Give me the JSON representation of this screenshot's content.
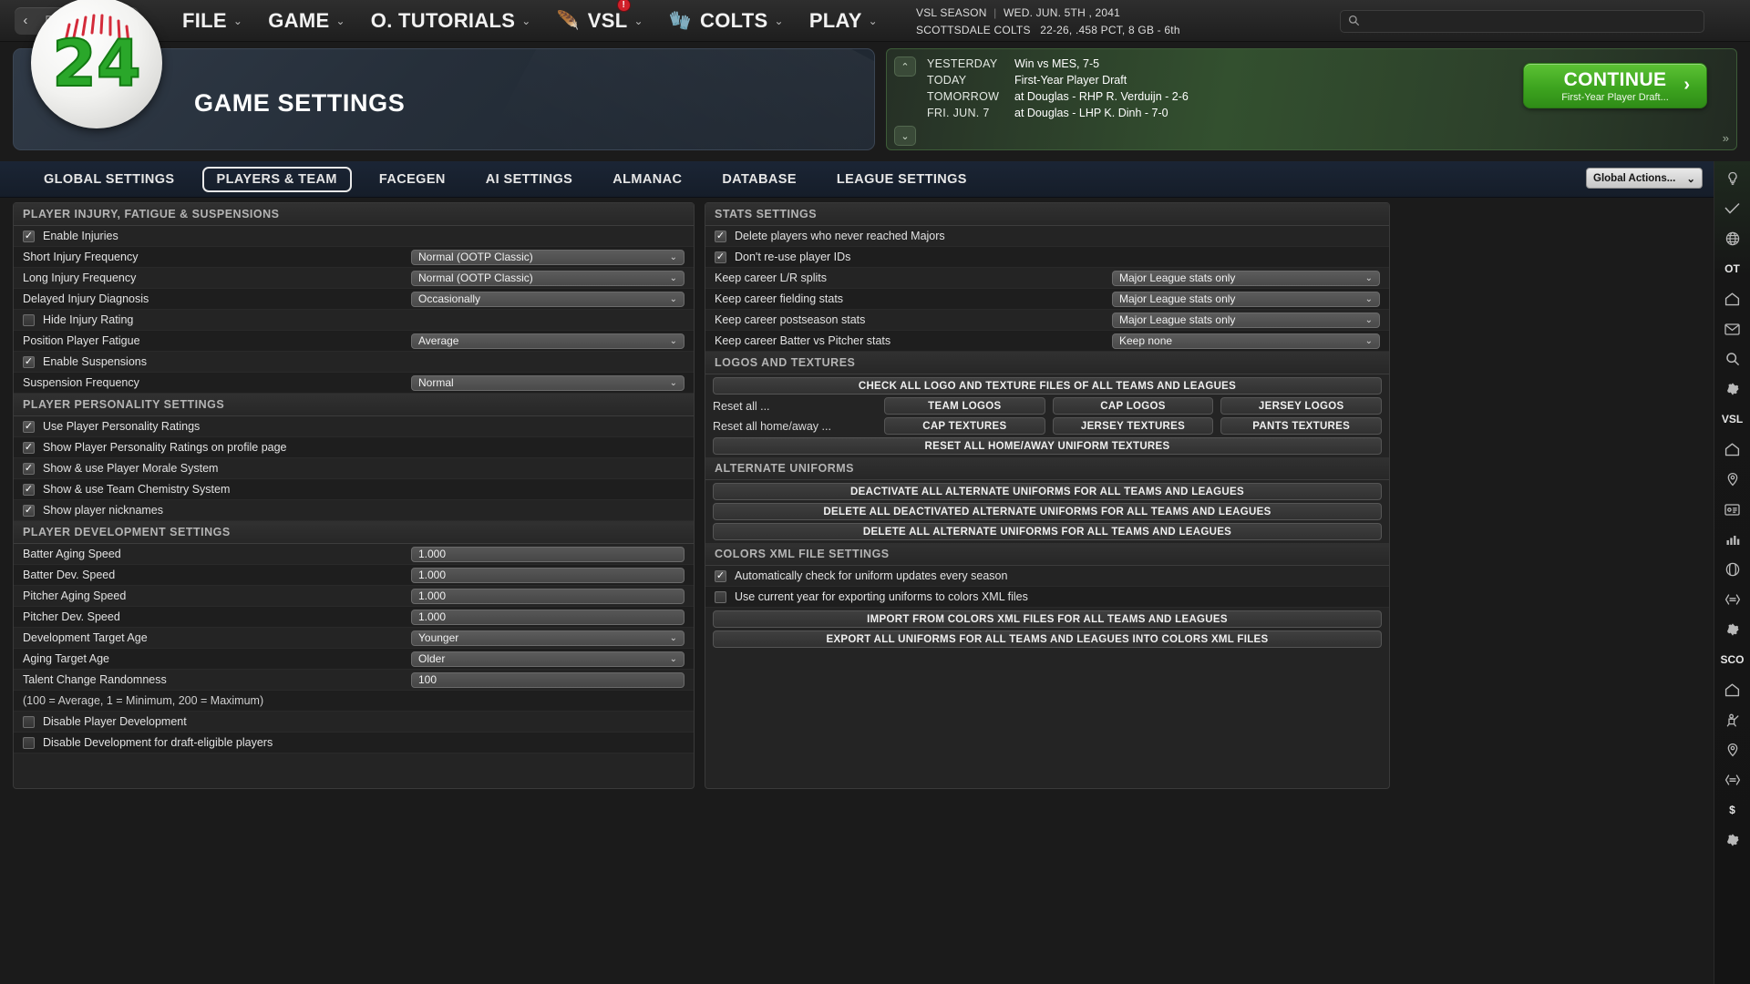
{
  "topbar": {
    "nav": {
      "back": "‹",
      "tab": "▯",
      "forward": "›",
      "favorite": "☆",
      "home": "⌂"
    },
    "menus": [
      {
        "label": "FILE",
        "icon": null,
        "badge": null
      },
      {
        "label": "GAME",
        "icon": null,
        "badge": null
      },
      {
        "label": "O. TUTORIALS",
        "icon": null,
        "badge": null
      },
      {
        "label": "VSL",
        "icon": "🪶",
        "badge": "!"
      },
      {
        "label": "COLTS",
        "icon": "🧤",
        "badge": null
      },
      {
        "label": "PLAY",
        "icon": null,
        "badge": null
      }
    ],
    "chevron": "⌄",
    "season_label": "VSL SEASON",
    "season_date": "WED. JUN. 5TH , 2041",
    "team_name": "SCOTTSDALE COLTS",
    "team_record": "22-26, .458 PCT, 8 GB - 6th",
    "search_placeholder": ""
  },
  "banner": {
    "title": "GAME SETTINGS",
    "logo_number": "24"
  },
  "schedule": {
    "rows": [
      {
        "when": "YESTERDAY",
        "what": "Win vs MES, 7-5"
      },
      {
        "when": "TODAY",
        "what": "First-Year Player Draft"
      },
      {
        "when": "TOMORROW",
        "what": "at Douglas - RHP R. Verduijn - 2-6"
      },
      {
        "when": "FRI. JUN. 7",
        "what": "at Douglas - LHP K. Dinh - 7-0"
      }
    ],
    "continue_label": "CONTINUE",
    "continue_sub": "First-Year Player Draft...",
    "continue_arrow": "›",
    "up_arrow": "⌃",
    "down_arrow": "⌄",
    "expand": "»"
  },
  "tabs": [
    {
      "label": "GLOBAL SETTINGS",
      "active": false
    },
    {
      "label": "PLAYERS & TEAM",
      "active": true
    },
    {
      "label": "FACEGEN",
      "active": false
    },
    {
      "label": "AI SETTINGS",
      "active": false
    },
    {
      "label": "ALMANAC",
      "active": false
    },
    {
      "label": "DATABASE",
      "active": false
    },
    {
      "label": "LEAGUE SETTINGS",
      "active": false
    }
  ],
  "global_actions": {
    "label": "Global Actions...",
    "chevron": "⌄"
  },
  "left_panel": {
    "sections": [
      {
        "title": "PLAYER INJURY, FATIGUE & SUSPENSIONS",
        "rows": [
          {
            "type": "checkbox",
            "label": "Enable Injuries",
            "checked": true
          },
          {
            "type": "select",
            "label": "Short Injury Frequency",
            "value": "Normal (OOTP Classic)"
          },
          {
            "type": "select",
            "label": "Long Injury Frequency",
            "value": "Normal (OOTP Classic)"
          },
          {
            "type": "select",
            "label": "Delayed Injury Diagnosis",
            "value": "Occasionally"
          },
          {
            "type": "checkbox",
            "label": "Hide Injury Rating",
            "checked": false
          },
          {
            "type": "select",
            "label": "Position Player Fatigue",
            "value": "Average"
          },
          {
            "type": "checkbox",
            "label": "Enable Suspensions",
            "checked": true
          },
          {
            "type": "select",
            "label": "Suspension Frequency",
            "value": "Normal"
          }
        ]
      },
      {
        "title": "PLAYER PERSONALITY SETTINGS",
        "rows": [
          {
            "type": "checkbox",
            "label": "Use Player Personality Ratings",
            "checked": true
          },
          {
            "type": "checkbox",
            "label": "Show Player Personality Ratings on profile page",
            "checked": true
          },
          {
            "type": "checkbox",
            "label": "Show & use Player Morale System",
            "checked": true
          },
          {
            "type": "checkbox",
            "label": "Show & use Team Chemistry System",
            "checked": true
          },
          {
            "type": "checkbox",
            "label": "Show player nicknames",
            "checked": true
          }
        ]
      },
      {
        "title": "PLAYER DEVELOPMENT SETTINGS",
        "rows": [
          {
            "type": "text",
            "label": "Batter Aging Speed",
            "value": "1.000"
          },
          {
            "type": "text",
            "label": "Batter Dev. Speed",
            "value": "1.000"
          },
          {
            "type": "text",
            "label": "Pitcher Aging Speed",
            "value": "1.000"
          },
          {
            "type": "text",
            "label": "Pitcher Dev. Speed",
            "value": "1.000"
          },
          {
            "type": "select",
            "label": "Development Target Age",
            "value": "Younger"
          },
          {
            "type": "select",
            "label": "Aging Target Age",
            "value": "Older"
          },
          {
            "type": "text",
            "label": "Talent Change Randomness",
            "value": "100"
          },
          {
            "type": "note",
            "label": "(100 = Average, 1 = Minimum, 200 = Maximum)"
          },
          {
            "type": "checkbox",
            "label": "Disable Player Development",
            "checked": false
          },
          {
            "type": "checkbox",
            "label": "Disable Development for draft-eligible players",
            "checked": false
          }
        ]
      }
    ]
  },
  "right_panel": {
    "sections": [
      {
        "title": "STATS SETTINGS",
        "rows": [
          {
            "type": "checkbox",
            "label": "Delete players who never reached Majors",
            "checked": true
          },
          {
            "type": "checkbox",
            "label": "Don't re-use player IDs",
            "checked": true
          },
          {
            "type": "select",
            "label": "Keep career L/R splits",
            "value": "Major League stats only"
          },
          {
            "type": "select",
            "label": "Keep career fielding stats",
            "value": "Major League stats only"
          },
          {
            "type": "select",
            "label": "Keep career postseason stats",
            "value": "Major League stats only"
          },
          {
            "type": "select",
            "label": "Keep career Batter vs Pitcher stats",
            "value": "Keep none"
          }
        ]
      },
      {
        "title": "LOGOS AND TEXTURES",
        "rows": [
          {
            "type": "button-full",
            "label": "CHECK ALL LOGO AND TEXTURE FILES OF ALL TEAMS AND LEAGUES"
          },
          {
            "type": "button-group",
            "label": "Reset all ...",
            "buttons": [
              "TEAM LOGOS",
              "CAP LOGOS",
              "JERSEY LOGOS"
            ]
          },
          {
            "type": "button-group",
            "label": "Reset all home/away ...",
            "buttons": [
              "CAP TEXTURES",
              "JERSEY TEXTURES",
              "PANTS TEXTURES"
            ]
          },
          {
            "type": "button-full",
            "label": "RESET ALL HOME/AWAY UNIFORM TEXTURES"
          }
        ]
      },
      {
        "title": "ALTERNATE UNIFORMS",
        "rows": [
          {
            "type": "button-full",
            "label": "DEACTIVATE ALL ALTERNATE UNIFORMS FOR ALL TEAMS AND LEAGUES"
          },
          {
            "type": "button-full",
            "label": "DELETE ALL DEACTIVATED ALTERNATE UNIFORMS FOR ALL TEAMS AND LEAGUES"
          },
          {
            "type": "button-full",
            "label": "DELETE ALL ALTERNATE UNIFORMS FOR ALL TEAMS AND LEAGUES"
          }
        ]
      },
      {
        "title": "COLORS XML FILE SETTINGS",
        "rows": [
          {
            "type": "checkbox",
            "label": "Automatically check for uniform updates every season",
            "checked": true
          },
          {
            "type": "checkbox",
            "label": "Use current year for exporting uniforms to colors XML files",
            "checked": false
          },
          {
            "type": "button-full",
            "label": "IMPORT FROM COLORS XML FILES FOR ALL TEAMS AND LEAGUES"
          },
          {
            "type": "button-full",
            "label": "EXPORT ALL UNIFORMS FOR ALL TEAMS AND LEAGUES INTO COLORS XML FILES"
          }
        ]
      }
    ]
  },
  "rail": {
    "icons": [
      {
        "name": "lightbulb-icon",
        "glyph": "svg:bulb"
      },
      {
        "name": "check-icon",
        "glyph": "svg:check"
      },
      {
        "name": "globe-icon",
        "glyph": "svg:globe"
      },
      {
        "name": "ot-label-icon",
        "glyph": "OT"
      },
      {
        "name": "home-icon",
        "glyph": "svg:home"
      },
      {
        "name": "mail-icon",
        "glyph": "svg:mail"
      },
      {
        "name": "search-icon",
        "glyph": "svg:search"
      },
      {
        "name": "gear-icon",
        "glyph": "svg:gear"
      },
      {
        "name": "vsl-label-icon",
        "glyph": "VSL"
      },
      {
        "name": "home-league-icon",
        "glyph": "svg:home"
      },
      {
        "name": "location-pin-icon",
        "glyph": "svg:pin"
      },
      {
        "name": "id-card-icon",
        "glyph": "svg:card"
      },
      {
        "name": "bar-chart-icon",
        "glyph": "svg:bars"
      },
      {
        "name": "baseball-icon",
        "glyph": "svg:ball"
      },
      {
        "name": "transactions-icon",
        "glyph": "svg:trans"
      },
      {
        "name": "gear-league-icon",
        "glyph": "svg:gear"
      },
      {
        "name": "sco-label-icon",
        "glyph": "SCO"
      },
      {
        "name": "home-team-icon",
        "glyph": "svg:home"
      },
      {
        "name": "batter-icon",
        "glyph": "svg:batter"
      },
      {
        "name": "location-pin-team-icon",
        "glyph": "svg:pin"
      },
      {
        "name": "transactions-team-icon",
        "glyph": "svg:trans"
      },
      {
        "name": "dollar-icon",
        "glyph": "$"
      },
      {
        "name": "gear-team-icon",
        "glyph": "svg:gear"
      }
    ]
  }
}
